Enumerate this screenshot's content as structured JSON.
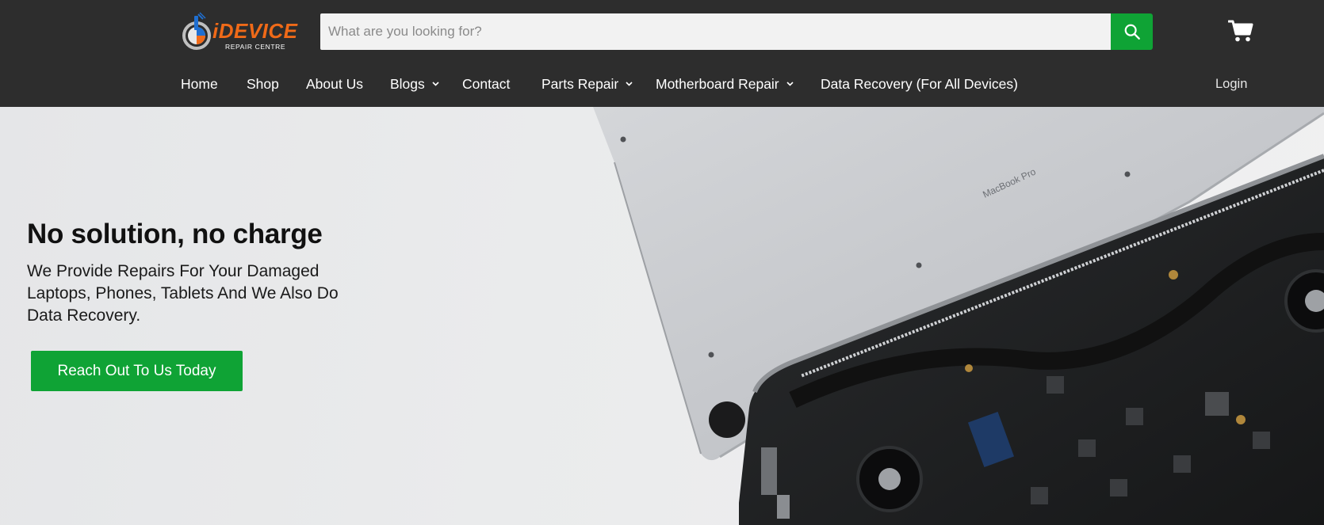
{
  "brand": {
    "name": "iDEVICE",
    "tagline": "REPAIR CENTRE"
  },
  "search": {
    "placeholder": "What are you looking for?",
    "value": "",
    "button_icon": "search-icon"
  },
  "cart": {
    "icon": "cart-icon"
  },
  "nav": {
    "items": [
      {
        "label": "Home",
        "has_dropdown": false
      },
      {
        "label": "Shop",
        "has_dropdown": false
      },
      {
        "label": "About Us",
        "has_dropdown": false
      },
      {
        "label": "Blogs",
        "has_dropdown": true
      },
      {
        "label": "Contact",
        "has_dropdown": false
      },
      {
        "label": "Parts Repair",
        "has_dropdown": true
      },
      {
        "label": "Motherboard Repair",
        "has_dropdown": true
      },
      {
        "label": "Data Recovery (For All Devices)",
        "has_dropdown": false
      }
    ],
    "login": "Login"
  },
  "hero": {
    "title": "No solution, no charge",
    "subtitle": "We Provide Repairs For Your Damaged Laptops, Phones, Tablets And We Also Do Data Recovery.",
    "cta": "Reach Out To Us Today",
    "laptop_label": "MacBook Pro"
  },
  "colors": {
    "header_bg": "#2d2d2d",
    "accent_green": "#0fa335",
    "logo_orange": "#f06a18",
    "logo_blue": "#1f6fd1"
  }
}
